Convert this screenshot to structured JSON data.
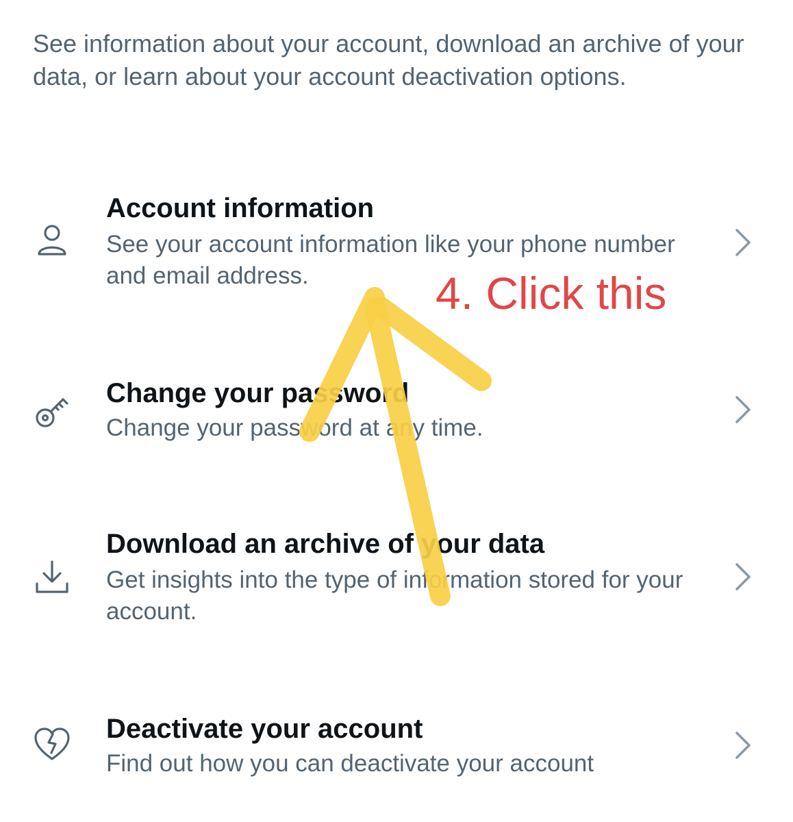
{
  "intro_text": "See information about your account, download an archive of your data, or learn about your account deactivation options.",
  "menu_items": [
    {
      "title": "Account information",
      "description": "See your account information like your phone number and email address.",
      "icon": "person-icon"
    },
    {
      "title": "Change your password",
      "description": "Change your password at any time.",
      "icon": "key-icon"
    },
    {
      "title": "Download an archive of your data",
      "description": "Get insights into the type of information stored for your account.",
      "icon": "download-icon"
    },
    {
      "title": "Deactivate your account",
      "description": "Find out how you can deactivate your account",
      "icon": "broken-heart-icon"
    }
  ],
  "annotation": {
    "text": "4. Click this",
    "text_color": "#e24646",
    "arrow_color": "#f7cf45"
  },
  "colors": {
    "title": "#0f1419",
    "secondary_text": "#536471",
    "chevron": "#8b98a5"
  }
}
